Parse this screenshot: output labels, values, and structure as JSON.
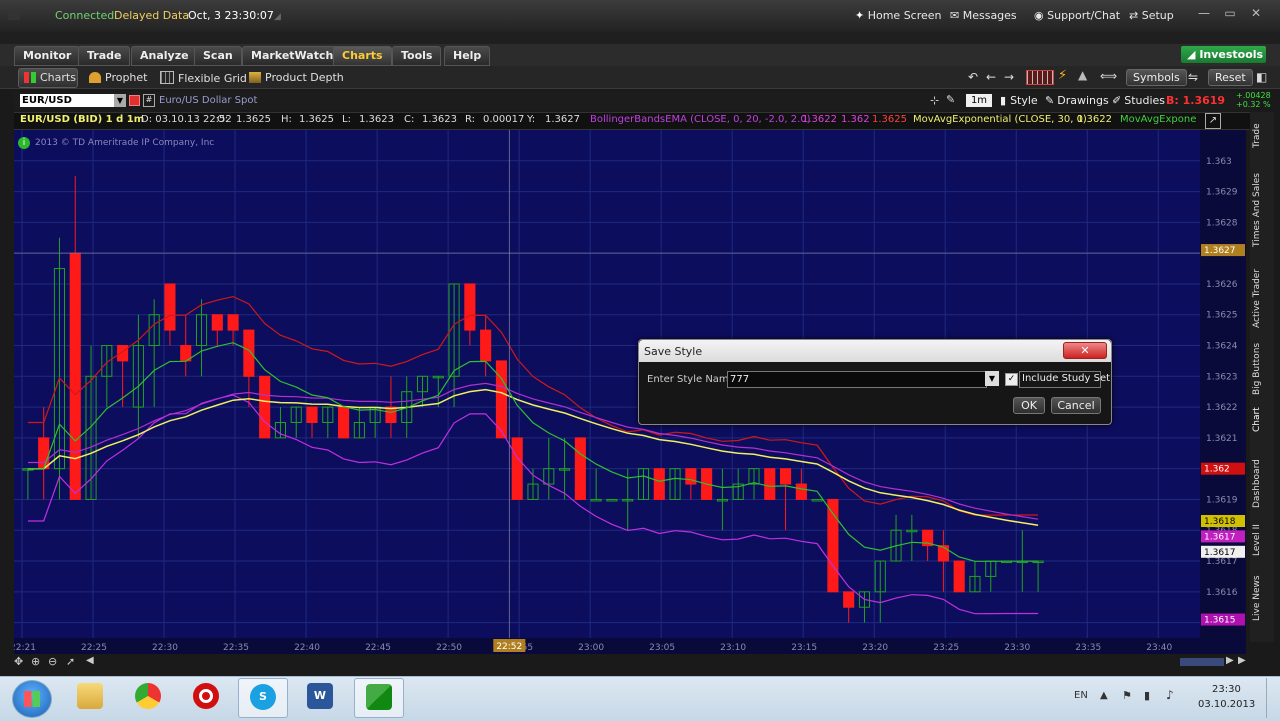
{
  "titlebar": {
    "connected": "Connected",
    "delayed": "Delayed Data",
    "datetime": "Oct, 3  23:30:07",
    "home": "Home Screen",
    "messages": "Messages",
    "support": "Support/Chat",
    "setup": "Setup"
  },
  "menu": {
    "tabs": [
      "Monitor",
      "Trade",
      "Analyze",
      "Scan",
      "MarketWatch",
      "Charts",
      "Tools",
      "Help"
    ],
    "active_tab": "Charts",
    "brand": "Investools"
  },
  "subtoolbar": {
    "charts": "Charts",
    "prophet": "Prophet",
    "flexible_grid": "Flexible Grid",
    "product_depth": "Product Depth",
    "symbols": "Symbols",
    "reset": "Reset"
  },
  "symbolbar": {
    "symbol": "EUR/USD",
    "description": "Euro/US Dollar Spot",
    "timeframe": "1m",
    "style": "Style",
    "drawings": "Drawings",
    "studies": "Studies",
    "bid": "B: 1.3619",
    "change_abs": "+.00428",
    "change_pct": "+0.32 %"
  },
  "infobar": {
    "series": "EUR/USD (BID) 1 d 1m",
    "date": "D: 03.10.13 22:52",
    "open_label": "O:",
    "open": "1.3625",
    "high_label": "H:",
    "high": "1.3625",
    "low_label": "L:",
    "low": "1.3623",
    "close_label": "C:",
    "close": "1.3623",
    "range_label": "R:",
    "range": "0.00017",
    "y_label": "Y:",
    "y": "1.3627",
    "bollinger": "BollingerBandsEMA (CLOSE, 0, 20, -2.0, 2.0)",
    "boll_v1": "1.3622",
    "boll_v2": "1.362",
    "boll_v3": "1.3625",
    "movavg": "MovAvgExponential (CLOSE, 30, 0)",
    "movavg_v": "1.3622",
    "movavg2": "MovAvgExpone"
  },
  "chart": {
    "copyright": "2013 © TD Ameritrade IP Company, Inc",
    "cursor_time": "22:52",
    "price_badges": {
      "cursor": "1.3627",
      "red": "1.362",
      "yellow": "1.3618",
      "magenta": "1.3617",
      "white": "1.3617",
      "bottom": "1.3615"
    },
    "colors": {
      "background": "#0d0d5e",
      "bull": "#1ea41e",
      "bear": "#ff1a1a",
      "ema": "#f0f060",
      "bb_upper": "#d01818",
      "bb_lower": "#c030e0"
    }
  },
  "chart_data": {
    "type": "candlestick",
    "title": "",
    "xlabel": "",
    "ylabel": "",
    "x_ticks": [
      "22:21",
      "22:25",
      "22:30",
      "22:35",
      "22:40",
      "22:45",
      "22:50",
      "22:55",
      "23:00",
      "23:05",
      "23:10",
      "23:15",
      "23:20",
      "23:25",
      "23:30",
      "23:35",
      "23:40"
    ],
    "y_ticks": [
      "1.363",
      "1.3629",
      "1.3628",
      "1.3627",
      "1.3626",
      "1.3625",
      "1.3624",
      "1.3623",
      "1.3622",
      "1.3621",
      "1.362",
      "1.3619",
      "1.3618",
      "1.3617",
      "1.3616",
      "1.3615"
    ],
    "ylim": [
      1.36145,
      1.3631
    ],
    "x_start_minute": 0,
    "candles": [
      {
        "o": 1.362,
        "h": 1.362,
        "l": 1.3619,
        "c": 1.362
      },
      {
        "o": 1.3621,
        "h": 1.3622,
        "l": 1.3619,
        "c": 1.362
      },
      {
        "o": 1.362,
        "h": 1.36275,
        "l": 1.3619,
        "c": 1.36265
      },
      {
        "o": 1.3627,
        "h": 1.36295,
        "l": 1.3619,
        "c": 1.3619
      },
      {
        "o": 1.3619,
        "h": 1.3624,
        "l": 1.3619,
        "c": 1.3623
      },
      {
        "o": 1.3623,
        "h": 1.3624,
        "l": 1.3622,
        "c": 1.3624
      },
      {
        "o": 1.3624,
        "h": 1.3624,
        "l": 1.3622,
        "c": 1.36235
      },
      {
        "o": 1.3622,
        "h": 1.3625,
        "l": 1.3621,
        "c": 1.3624
      },
      {
        "o": 1.3624,
        "h": 1.36255,
        "l": 1.3622,
        "c": 1.3625
      },
      {
        "o": 1.3626,
        "h": 1.3626,
        "l": 1.3624,
        "c": 1.36245
      },
      {
        "o": 1.3624,
        "h": 1.3625,
        "l": 1.3623,
        "c": 1.36235
      },
      {
        "o": 1.3624,
        "h": 1.36255,
        "l": 1.3623,
        "c": 1.3625
      },
      {
        "o": 1.3625,
        "h": 1.3625,
        "l": 1.3624,
        "c": 1.36245
      },
      {
        "o": 1.3625,
        "h": 1.3625,
        "l": 1.3624,
        "c": 1.36245
      },
      {
        "o": 1.36245,
        "h": 1.36245,
        "l": 1.3622,
        "c": 1.3623
      },
      {
        "o": 1.3623,
        "h": 1.3623,
        "l": 1.3621,
        "c": 1.3621
      },
      {
        "o": 1.3621,
        "h": 1.3622,
        "l": 1.3621,
        "c": 1.36215
      },
      {
        "o": 1.36215,
        "h": 1.3622,
        "l": 1.3621,
        "c": 1.3622
      },
      {
        "o": 1.3622,
        "h": 1.3622,
        "l": 1.3621,
        "c": 1.36215
      },
      {
        "o": 1.36215,
        "h": 1.3622,
        "l": 1.3621,
        "c": 1.3622
      },
      {
        "o": 1.3622,
        "h": 1.3622,
        "l": 1.3621,
        "c": 1.3621
      },
      {
        "o": 1.3621,
        "h": 1.3622,
        "l": 1.3621,
        "c": 1.36215
      },
      {
        "o": 1.36215,
        "h": 1.3622,
        "l": 1.3621,
        "c": 1.3622
      },
      {
        "o": 1.3622,
        "h": 1.3623,
        "l": 1.3621,
        "c": 1.36215
      },
      {
        "o": 1.36215,
        "h": 1.3623,
        "l": 1.3621,
        "c": 1.36225
      },
      {
        "o": 1.36225,
        "h": 1.3623,
        "l": 1.3622,
        "c": 1.3623
      },
      {
        "o": 1.3623,
        "h": 1.3623,
        "l": 1.3622,
        "c": 1.3623
      },
      {
        "o": 1.3623,
        "h": 1.3626,
        "l": 1.3622,
        "c": 1.3626
      },
      {
        "o": 1.3626,
        "h": 1.3626,
        "l": 1.3624,
        "c": 1.36245
      },
      {
        "o": 1.36245,
        "h": 1.3625,
        "l": 1.3623,
        "c": 1.36235
      },
      {
        "o": 1.36235,
        "h": 1.36235,
        "l": 1.3621,
        "c": 1.3621
      },
      {
        "o": 1.3621,
        "h": 1.3621,
        "l": 1.3619,
        "c": 1.3619
      },
      {
        "o": 1.3619,
        "h": 1.362,
        "l": 1.3619,
        "c": 1.36195
      },
      {
        "o": 1.36195,
        "h": 1.3621,
        "l": 1.3619,
        "c": 1.362
      },
      {
        "o": 1.362,
        "h": 1.3621,
        "l": 1.3619,
        "c": 1.362
      },
      {
        "o": 1.3621,
        "h": 1.3621,
        "l": 1.3619,
        "c": 1.3619
      },
      {
        "o": 1.3619,
        "h": 1.362,
        "l": 1.3619,
        "c": 1.3619
      },
      {
        "o": 1.3619,
        "h": 1.3619,
        "l": 1.3619,
        "c": 1.3619
      },
      {
        "o": 1.3619,
        "h": 1.362,
        "l": 1.3618,
        "c": 1.3619
      },
      {
        "o": 1.3619,
        "h": 1.362,
        "l": 1.3619,
        "c": 1.362
      },
      {
        "o": 1.362,
        "h": 1.362,
        "l": 1.3619,
        "c": 1.3619
      },
      {
        "o": 1.3619,
        "h": 1.362,
        "l": 1.3619,
        "c": 1.362
      },
      {
        "o": 1.362,
        "h": 1.362,
        "l": 1.3619,
        "c": 1.36195
      },
      {
        "o": 1.362,
        "h": 1.362,
        "l": 1.3619,
        "c": 1.3619
      },
      {
        "o": 1.3619,
        "h": 1.362,
        "l": 1.3618,
        "c": 1.3619
      },
      {
        "o": 1.3619,
        "h": 1.362,
        "l": 1.3619,
        "c": 1.36195
      },
      {
        "o": 1.36195,
        "h": 1.362,
        "l": 1.3619,
        "c": 1.362
      },
      {
        "o": 1.362,
        "h": 1.362,
        "l": 1.3619,
        "c": 1.3619
      },
      {
        "o": 1.362,
        "h": 1.362,
        "l": 1.3618,
        "c": 1.36195
      },
      {
        "o": 1.36195,
        "h": 1.362,
        "l": 1.3619,
        "c": 1.3619
      },
      {
        "o": 1.3619,
        "h": 1.3619,
        "l": 1.3619,
        "c": 1.3619
      },
      {
        "o": 1.3619,
        "h": 1.3619,
        "l": 1.3616,
        "c": 1.3616
      },
      {
        "o": 1.3616,
        "h": 1.3616,
        "l": 1.3615,
        "c": 1.36155
      },
      {
        "o": 1.36155,
        "h": 1.3616,
        "l": 1.3615,
        "c": 1.3616
      },
      {
        "o": 1.3616,
        "h": 1.3617,
        "l": 1.3615,
        "c": 1.3617
      },
      {
        "o": 1.3617,
        "h": 1.36185,
        "l": 1.3617,
        "c": 1.3618
      },
      {
        "o": 1.3618,
        "h": 1.36185,
        "l": 1.3617,
        "c": 1.3618
      },
      {
        "o": 1.3618,
        "h": 1.3618,
        "l": 1.3617,
        "c": 1.36175
      },
      {
        "o": 1.36175,
        "h": 1.3618,
        "l": 1.3616,
        "c": 1.3617
      },
      {
        "o": 1.3617,
        "h": 1.3617,
        "l": 1.3616,
        "c": 1.3616
      },
      {
        "o": 1.3616,
        "h": 1.3617,
        "l": 1.3616,
        "c": 1.36165
      },
      {
        "o": 1.36165,
        "h": 1.3617,
        "l": 1.3616,
        "c": 1.3617
      },
      {
        "o": 1.3617,
        "h": 1.3617,
        "l": 1.3617,
        "c": 1.3617
      },
      {
        "o": 1.3617,
        "h": 1.3618,
        "l": 1.3616,
        "c": 1.3617
      },
      {
        "o": 1.3617,
        "h": 1.3617,
        "l": 1.3616,
        "c": 1.3617
      }
    ]
  },
  "dialog": {
    "title": "Save Style",
    "label": "Enter Style Name",
    "value": "777",
    "checkbox": "Include Study Set",
    "checked": true,
    "ok": "OK",
    "cancel": "Cancel"
  },
  "sidetabs": [
    "Trade",
    "Times And Sales",
    "Active Trader",
    "Big Buttons",
    "Chart",
    "Dashboard",
    "Level II",
    "Live News"
  ],
  "taskbar": {
    "lang": "EN",
    "time": "23:30",
    "date": "03.10.2013",
    "apps": [
      "start",
      "file-explorer",
      "chrome",
      "opera",
      "skype",
      "word",
      "thinkorswim"
    ]
  }
}
